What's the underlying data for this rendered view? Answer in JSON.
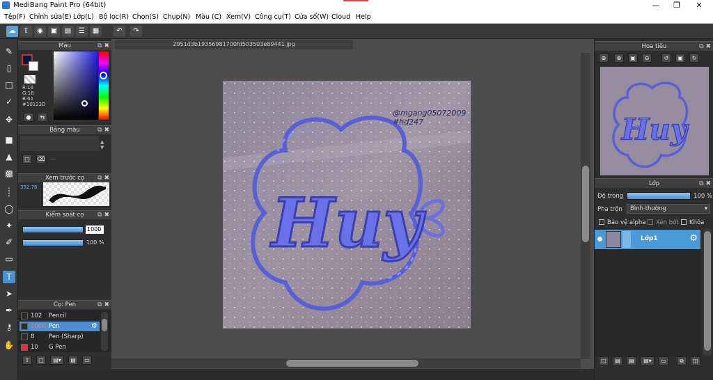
{
  "window": {
    "title": "MediBang Paint Pro (64bit)",
    "minimize_icon": "minimize-icon",
    "maximize_icon": "restore-icon",
    "close_icon": "close-icon"
  },
  "menu": [
    "Tệp(F)",
    "Chỉnh sửa(E)",
    "Lớp(L)",
    "Bộ lọc(R)",
    "Chọn(S)",
    "Chụp(N)",
    "Màu (C)",
    "Xem(V)",
    "Công cụ(T)",
    "Cửa sổ(W)",
    "Cloud",
    "Help"
  ],
  "document": {
    "tab_name": "2951d3b19356981700fd503503e89441.jpg"
  },
  "artwork": {
    "main_text": "Huy",
    "credit_line1": "@mgang05072009",
    "credit_line2": "#hd247"
  },
  "color_panel": {
    "title": "Màu",
    "r": "R:16",
    "g": "G:18",
    "b": "B:61",
    "hex": "#10123D",
    "fg_color": "#10123D",
    "accent": "#4a8fd0"
  },
  "palette_panel": {
    "title": "Bảng màu",
    "dash": "---"
  },
  "brush_preview": {
    "title": "Xem trước cọ",
    "size": "352.76"
  },
  "brush_control": {
    "title": "Kiểm soát cọ",
    "size_value": "1000",
    "opacity_value": "100 %"
  },
  "brush_list": {
    "title": "Cọ: Pen",
    "items": [
      {
        "size": "102",
        "name": "Pencil",
        "color": "#2b2b2b"
      },
      {
        "size": "1000",
        "name": "Pen",
        "color": "#2b2b2b"
      },
      {
        "size": "8",
        "name": "Pen (Sharp)",
        "color": "#2b2b2b"
      },
      {
        "size": "10",
        "name": "G Pen",
        "color": "#e03030"
      }
    ]
  },
  "navigator": {
    "title": "Hoa tiêu"
  },
  "layers": {
    "title": "Lớp",
    "opacity_label": "Độ trong",
    "opacity_value": "100 %",
    "blend_label": "Pha trộn",
    "blend_value": "Bình thường",
    "protect_alpha": "Bảo vệ alpha",
    "clipping": "Xén bớt",
    "lock": "Khóa",
    "layer_name": "Lớp1"
  }
}
